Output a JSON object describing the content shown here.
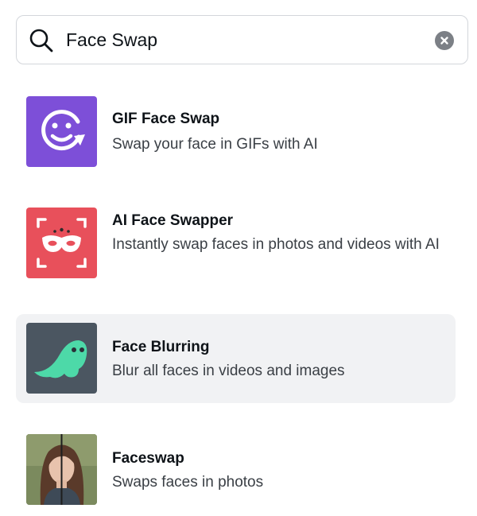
{
  "search": {
    "value": "Face Swap",
    "icon": "search-icon",
    "clear_icon": "clear-icon"
  },
  "results": [
    {
      "title": "GIF Face Swap",
      "description": "Swap your face in GIFs with AI",
      "icon": "smiley-swap-icon",
      "icon_bg": "#7d4fd8",
      "highlighted": false
    },
    {
      "title": "AI Face Swapper",
      "description": "Instantly swap faces in photos and videos with AI",
      "icon": "masquerade-mask-icon",
      "icon_bg": "#e8505b",
      "highlighted": false
    },
    {
      "title": "Face Blurring",
      "description": "Blur all faces in videos and images",
      "icon": "ghost-icon",
      "icon_bg": "#4b5661",
      "highlighted": true
    },
    {
      "title": "Faceswap",
      "description": "Swaps faces in photos",
      "icon": "portrait-photo-thumbnail",
      "highlighted": false
    }
  ],
  "colors": {
    "highlight_bg": "#f1f2f4",
    "border": "#d3d6db",
    "text_primary": "#0e1318",
    "text_secondary": "#3a3f45",
    "ghost_green": "#4dd9a8"
  }
}
